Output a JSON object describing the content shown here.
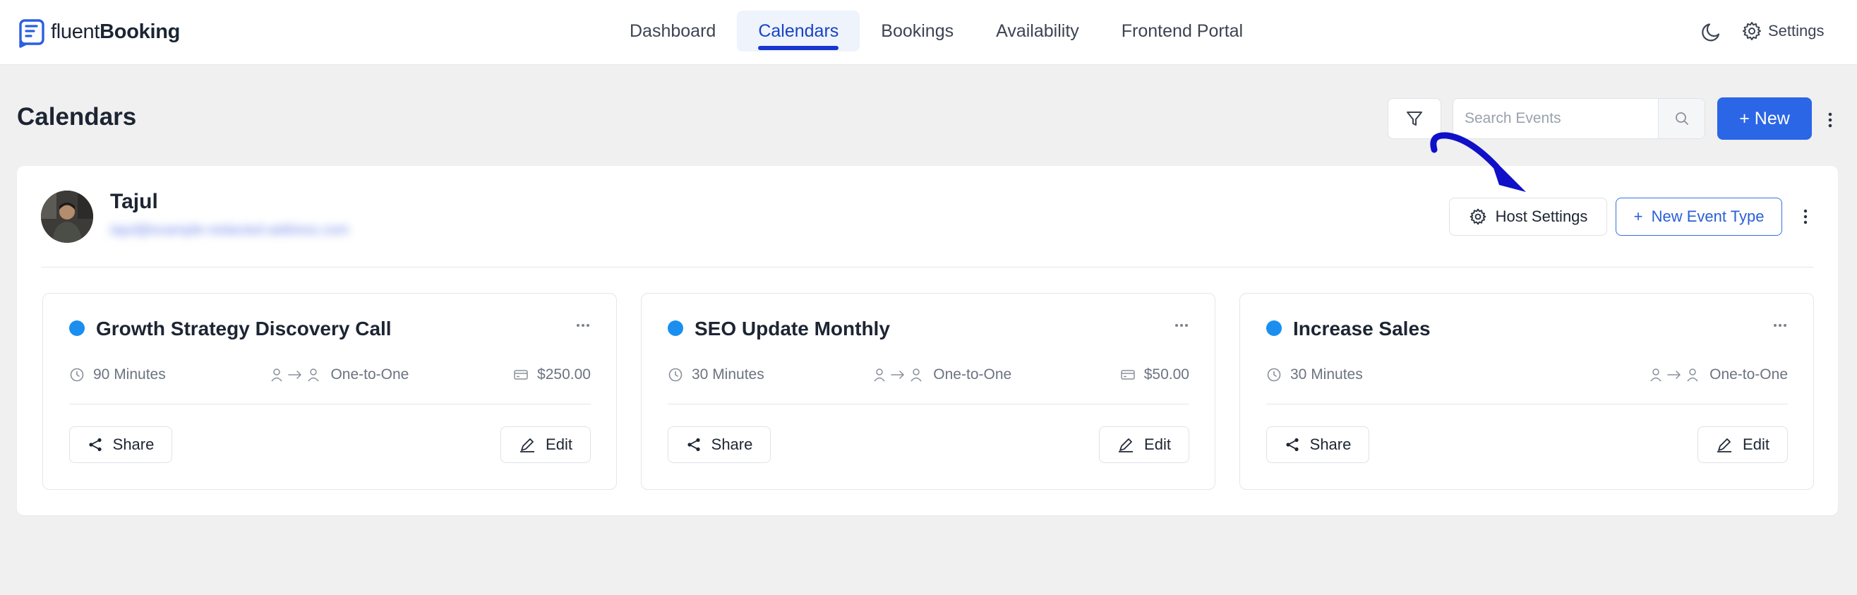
{
  "brand": {
    "name_light": "fluent",
    "name_bold": "Booking"
  },
  "nav": {
    "items": [
      {
        "label": "Dashboard",
        "active": false
      },
      {
        "label": "Calendars",
        "active": true
      },
      {
        "label": "Bookings",
        "active": false
      },
      {
        "label": "Availability",
        "active": false
      },
      {
        "label": "Frontend Portal",
        "active": false
      }
    ],
    "settings_label": "Settings",
    "theme_icon": "moon-icon"
  },
  "page": {
    "title": "Calendars",
    "search_placeholder": "Search Events",
    "new_label": "+ New"
  },
  "host": {
    "name": "Tajul",
    "email_blurred": "tajul@example-redacted-address.com",
    "host_settings_label": "Host Settings",
    "new_event_type_label": "+  New Event Type"
  },
  "events": [
    {
      "title": "Growth Strategy Discovery Call",
      "duration": "90 Minutes",
      "type": "One-to-One",
      "price": "$250.00",
      "share_label": "Share",
      "edit_label": "Edit"
    },
    {
      "title": "SEO Update Monthly",
      "duration": "30 Minutes",
      "type": "One-to-One",
      "price": "$50.00",
      "share_label": "Share",
      "edit_label": "Edit"
    },
    {
      "title": "Increase Sales",
      "duration": "30 Minutes",
      "type": "One-to-One",
      "price": "",
      "share_label": "Share",
      "edit_label": "Edit"
    }
  ],
  "colors": {
    "primary": "#2a66e6",
    "nav_active_text": "#1743c7",
    "nav_active_underline": "#1a35cf",
    "event_dot": "#1a8ff0",
    "annotation_arrow": "#1010c8"
  }
}
